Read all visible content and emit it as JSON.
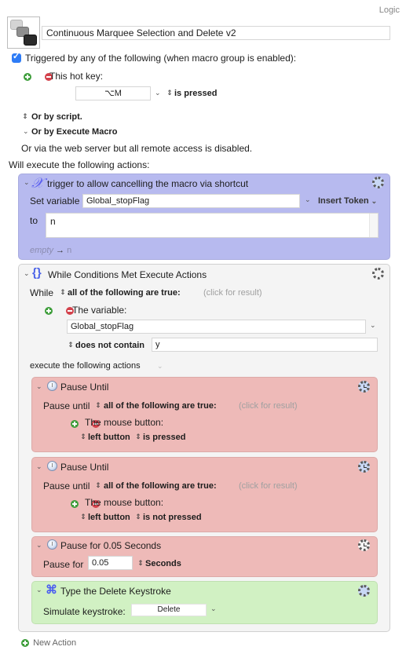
{
  "header": {
    "group_label": "Logic",
    "macro_name": "Continuous Marquee Selection and Delete v2"
  },
  "triggers": {
    "enabled_checkbox_label": "Triggered by any of the following (when macro group is enabled):",
    "enabled": true,
    "hotkey_label": "This hot key:",
    "hotkey_value": "⌥M",
    "hotkey_condition": "is pressed",
    "by_script": "Or by script.",
    "by_execute_macro": "Or by Execute Macro",
    "web_server": "Or via the web server but all remote access is disabled."
  },
  "actions_heading": "Will execute the following actions:",
  "set_variable_action": {
    "title": "trigger to allow cancelling the macro via shortcut",
    "set_variable_label": "Set variable",
    "variable_name": "Global_stopFlag",
    "insert_token_label": "Insert Token",
    "to_label": "to",
    "to_value": "n",
    "preview_empty": "empty",
    "preview_arrow": "→",
    "preview_value": "n",
    "color": "#b7baef"
  },
  "while_action": {
    "title": "While Conditions Met Execute Actions",
    "while_label": "While",
    "condition_mode": "all of the following are true:",
    "click_for_result": "(click for result)",
    "condition_type_label": "The variable:",
    "variable_name": "Global_stopFlag",
    "operator": "does not contain",
    "operand": "y",
    "execute_label": "execute the following actions",
    "sub_actions": [
      {
        "title": "Pause Until",
        "pause_label": "Pause until",
        "condition_mode": "all of the following are true:",
        "click_for_result": "(click for result)",
        "condition_type_label": "The mouse button:",
        "button": "left button",
        "state": "is pressed",
        "color": "#eebab8"
      },
      {
        "title": "Pause Until",
        "pause_label": "Pause until",
        "condition_mode": "all of the following are true:",
        "click_for_result": "(click for result)",
        "condition_type_label": "The mouse button:",
        "button": "left button",
        "state": "is not pressed",
        "color": "#eebab8"
      },
      {
        "title": "Pause for 0.05 Seconds",
        "pause_for_label": "Pause for",
        "value": "0.05",
        "unit": "Seconds",
        "color": "#eebab8"
      },
      {
        "title": "Type the Delete Keystroke",
        "simulate_label": "Simulate keystroke:",
        "keystroke": "Delete",
        "color": "#d1f1c3"
      }
    ]
  },
  "new_action_label": "New Action"
}
